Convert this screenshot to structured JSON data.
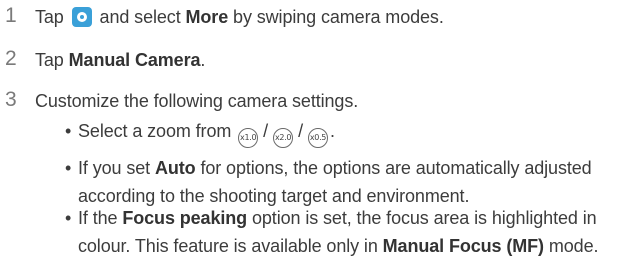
{
  "steps": [
    {
      "num": "1",
      "t1": "Tap",
      "t2": "and select",
      "b1": "More",
      "t3": "by swiping camera modes."
    },
    {
      "num": "2",
      "t1": "Tap",
      "b1": "Manual Camera",
      "t2": "."
    },
    {
      "num": "3",
      "t1": "Customize the following camera settings."
    }
  ],
  "bullets": [
    {
      "mark": "•",
      "t1": "Select a zoom from",
      "zoom": [
        "x1.0",
        "x2.0",
        "x0.5"
      ],
      "sep": "/",
      "end": "."
    },
    {
      "mark": "•",
      "t1": "If you set",
      "b1": "Auto",
      "t2": "for options, the options are automatically adjusted according to the shooting target and environment."
    },
    {
      "mark": "•",
      "t1": "If the",
      "b1": "Focus peaking",
      "t2": "option is set, the focus area is highlighted in colour. This feature is available only in",
      "b2": "Manual Focus (MF)",
      "t3": "mode."
    }
  ],
  "icons": {
    "camera": "camera-app-icon",
    "zoom": "zoom-level-icon"
  },
  "colors": {
    "camera_icon": "#3aa0d8",
    "text": "#3c3c3c"
  }
}
